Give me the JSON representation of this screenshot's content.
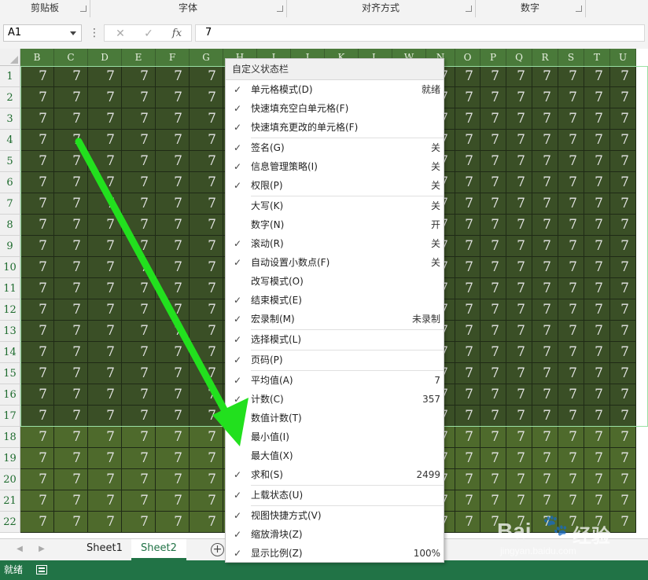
{
  "ribbon": {
    "groups": [
      "剪贴板",
      "字体",
      "对齐方式",
      "数字"
    ]
  },
  "formula_bar": {
    "name_box": "A1",
    "cancel_icon": "cancel-icon",
    "enter_icon": "check-icon",
    "fx_label": "fx",
    "formula": "7"
  },
  "grid": {
    "columns": [
      "B",
      "C",
      "D",
      "E",
      "F",
      "G",
      "H",
      "I",
      "J",
      "K",
      "L",
      "W",
      "N",
      "O",
      "P",
      "Q",
      "R",
      "S",
      "T",
      "U"
    ],
    "rows": [
      "1",
      "2",
      "3",
      "4",
      "5",
      "6",
      "7",
      "8",
      "9",
      "10",
      "11",
      "12",
      "13",
      "14",
      "15",
      "16",
      "17",
      "18",
      "19",
      "20",
      "21",
      "22"
    ],
    "cell_value": "7",
    "selected_rows": 17
  },
  "context_menu": {
    "title": "自定义状态栏",
    "items": [
      {
        "label": "单元格模式(D)",
        "checked": true,
        "value": "就绪",
        "sep_after": false
      },
      {
        "label": "快速填充空白单元格(F)",
        "checked": true,
        "value": "",
        "sep_after": false
      },
      {
        "label": "快速填充更改的单元格(F)",
        "checked": true,
        "value": "",
        "sep_after": true
      },
      {
        "label": "签名(G)",
        "checked": true,
        "value": "关",
        "sep_after": false
      },
      {
        "label": "信息管理策略(I)",
        "checked": true,
        "value": "关",
        "sep_after": false
      },
      {
        "label": "权限(P)",
        "checked": true,
        "value": "关",
        "sep_after": true
      },
      {
        "label": "大写(K)",
        "checked": false,
        "value": "关",
        "sep_after": false
      },
      {
        "label": "数字(N)",
        "checked": false,
        "value": "开",
        "sep_after": false
      },
      {
        "label": "滚动(R)",
        "checked": true,
        "value": "关",
        "sep_after": false
      },
      {
        "label": "自动设置小数点(F)",
        "checked": true,
        "value": "关",
        "sep_after": false
      },
      {
        "label": "改写模式(O)",
        "checked": false,
        "value": "",
        "sep_after": false
      },
      {
        "label": "结束模式(E)",
        "checked": true,
        "value": "",
        "sep_after": false
      },
      {
        "label": "宏录制(M)",
        "checked": true,
        "value": "未录制",
        "sep_after": true
      },
      {
        "label": "选择模式(L)",
        "checked": true,
        "value": "",
        "sep_after": true
      },
      {
        "label": "页码(P)",
        "checked": true,
        "value": "",
        "sep_after": true
      },
      {
        "label": "平均值(A)",
        "checked": true,
        "value": "7",
        "sep_after": false
      },
      {
        "label": "计数(C)",
        "checked": true,
        "value": "357",
        "sep_after": false
      },
      {
        "label": "数值计数(T)",
        "checked": false,
        "value": "",
        "sep_after": false
      },
      {
        "label": "最小值(I)",
        "checked": false,
        "value": "",
        "sep_after": false
      },
      {
        "label": "最大值(X)",
        "checked": false,
        "value": "",
        "sep_after": false
      },
      {
        "label": "求和(S)",
        "checked": true,
        "value": "2499",
        "sep_after": true
      },
      {
        "label": "上载状态(U)",
        "checked": true,
        "value": "",
        "sep_after": true
      },
      {
        "label": "视图快捷方式(V)",
        "checked": true,
        "value": "",
        "sep_after": false
      },
      {
        "label": "缩放滑块(Z)",
        "checked": true,
        "value": "",
        "sep_after": false
      },
      {
        "label": "显示比例(Z)",
        "checked": true,
        "value": "100%",
        "sep_after": false
      }
    ]
  },
  "tabs": {
    "sheets": [
      "Sheet1",
      "Sheet2"
    ],
    "active": "Sheet2",
    "add_icon": "add-sheet-icon"
  },
  "status_bar": {
    "ready": "就绪",
    "macro_icon": "macro-record-icon"
  },
  "watermark": {
    "logo": "Bai",
    "paw": "paw-icon",
    "cn": "经验",
    "url": "jingyan.baidu.com"
  },
  "colors": {
    "selected_cell": "#3a4f26",
    "unselected_cell": "#4e6a2c",
    "arrow": "#22e01e",
    "status_bar": "#217346"
  }
}
